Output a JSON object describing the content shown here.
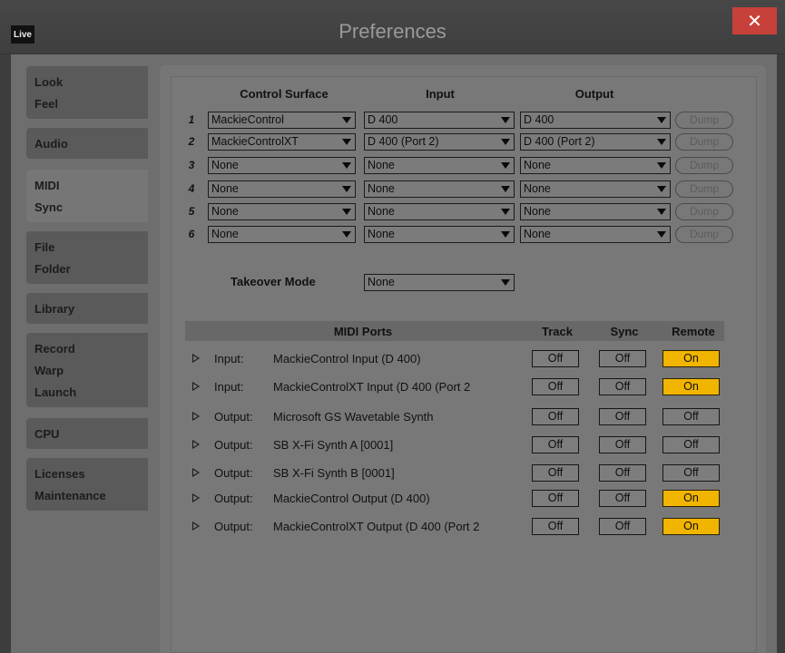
{
  "window": {
    "app_icon": "Live",
    "title": "Preferences",
    "close_glyph": "✕"
  },
  "sidebar": {
    "groups": [
      {
        "items": [
          "Look",
          "Feel"
        ]
      },
      {
        "items": [
          "Audio"
        ]
      },
      {
        "items": [
          "MIDI",
          "Sync"
        ],
        "active": true
      },
      {
        "items": [
          "File",
          "Folder"
        ]
      },
      {
        "items": [
          "Library"
        ]
      },
      {
        "items": [
          "Record",
          "Warp",
          "Launch"
        ]
      },
      {
        "items": [
          "CPU"
        ]
      },
      {
        "items": [
          "Licenses",
          "Maintenance"
        ]
      }
    ]
  },
  "surfaces": {
    "headers": {
      "surface": "Control Surface",
      "input": "Input",
      "output": "Output"
    },
    "dump_label": "Dump",
    "rows": [
      {
        "num": "1",
        "surface": "MackieControl",
        "input": "D 400",
        "output": "D 400"
      },
      {
        "num": "2",
        "surface": "MackieControlXT",
        "input": "D 400 (Port 2)",
        "output": "D 400 (Port 2)"
      },
      {
        "num": "3",
        "surface": "None",
        "input": "None",
        "output": "None"
      },
      {
        "num": "4",
        "surface": "None",
        "input": "None",
        "output": "None"
      },
      {
        "num": "5",
        "surface": "None",
        "input": "None",
        "output": "None"
      },
      {
        "num": "6",
        "surface": "None",
        "input": "None",
        "output": "None"
      }
    ]
  },
  "takeover": {
    "label": "Takeover Mode",
    "value": "None"
  },
  "ports": {
    "headers": {
      "ports": "MIDI Ports",
      "track": "Track",
      "sync": "Sync",
      "remote": "Remote"
    },
    "on_color": "#f1b500",
    "rows": [
      {
        "dir": "Input:",
        "name": "MackieControl Input (D 400)",
        "track": "Off",
        "sync": "Off",
        "remote": "On"
      },
      {
        "dir": "Input:",
        "name": "MackieControlXT Input (D 400 (Port 2",
        "track": "Off",
        "sync": "Off",
        "remote": "On"
      },
      {
        "dir": "Output:",
        "name": "Microsoft GS Wavetable Synth",
        "track": "Off",
        "sync": "Off",
        "remote": "Off"
      },
      {
        "dir": "Output:",
        "name": "SB X-Fi Synth A [0001]",
        "track": "Off",
        "sync": "Off",
        "remote": "Off"
      },
      {
        "dir": "Output:",
        "name": "SB X-Fi Synth B [0001]",
        "track": "Off",
        "sync": "Off",
        "remote": "Off"
      },
      {
        "dir": "Output:",
        "name": "MackieControl Output (D 400)",
        "track": "Off",
        "sync": "Off",
        "remote": "On"
      },
      {
        "dir": "Output:",
        "name": "MackieControlXT Output (D 400 (Port 2",
        "track": "Off",
        "sync": "Off",
        "remote": "On"
      }
    ]
  }
}
